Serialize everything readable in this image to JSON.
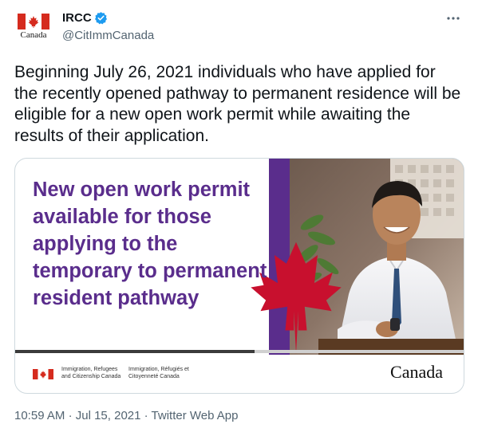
{
  "author": {
    "name": "IRCC",
    "handle": "@CitImmCanada",
    "avatar_wordmark": "Canada",
    "verified": true
  },
  "tweet": {
    "text": "Beginning July 26, 2021 individuals who have applied for the recently opened pathway to permanent residence will be eligible for a new open work permit while awaiting the results of their application."
  },
  "media": {
    "headline": "New open work permit available for those applying to the temporary to permanent resident pathway",
    "dept_en": "Immigration, Refugees and Citizenship Canada",
    "dept_fr": "Immigration, Réfugiés et Citoyenneté Canada",
    "wordmark": "Canada"
  },
  "meta": {
    "time": "10:59 AM",
    "separator": "·",
    "date": "Jul 15, 2021",
    "client": "Twitter Web App"
  },
  "icons": {
    "more": "more-icon",
    "verified": "verified-badge-icon",
    "flag": "canada-flag-icon",
    "leaf": "maple-leaf-icon"
  },
  "colors": {
    "accent_purple": "#5a2d8c",
    "verified_blue": "#1d9bf0",
    "flag_red": "#d52b1e",
    "leaf_red": "#c8102e",
    "secondary_text": "#536471"
  }
}
